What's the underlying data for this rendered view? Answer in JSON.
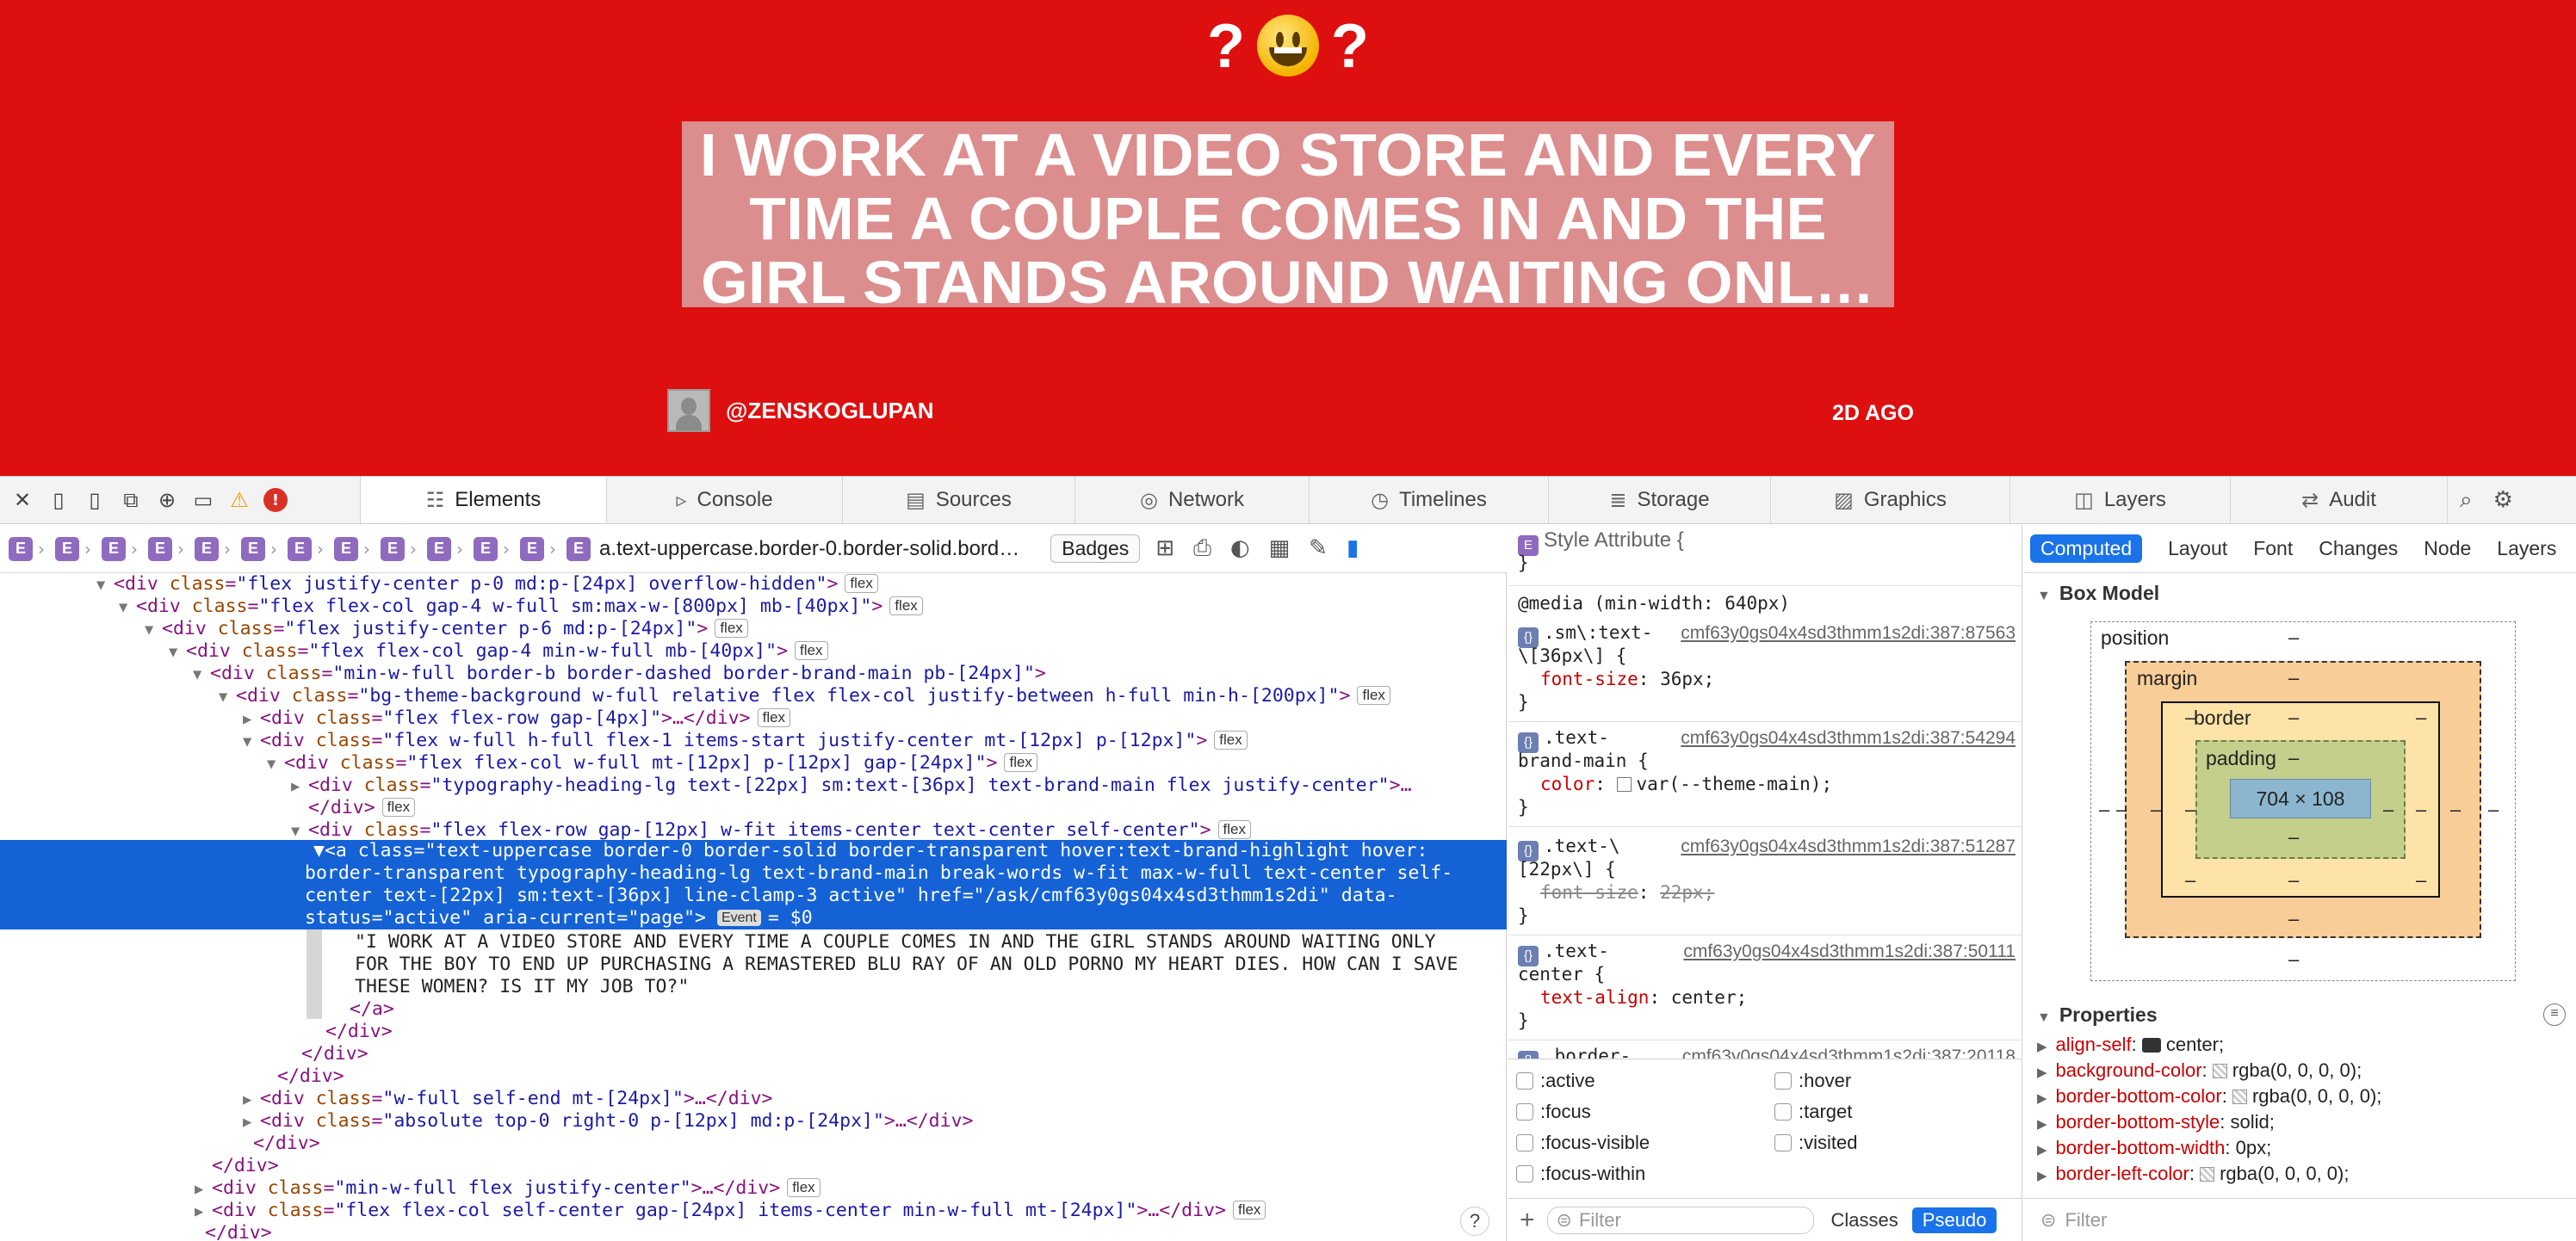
{
  "page": {
    "emoji_left": "?",
    "emoji_right": "?",
    "headline": "I WORK AT A VIDEO STORE AND EVERY TIME A COUPLE COMES IN AND THE GIRL STANDS AROUND WAITING ONL…",
    "author": "@ZENSKOGLUPAN",
    "age": "2D AGO",
    "colors": {
      "background": "#de0f0f",
      "text": "#ffffff"
    }
  },
  "devtools": {
    "tabs": [
      {
        "label": "Elements",
        "icon": "elements-icon"
      },
      {
        "label": "Console",
        "icon": "console-icon"
      },
      {
        "label": "Sources",
        "icon": "sources-icon"
      },
      {
        "label": "Network",
        "icon": "network-icon"
      },
      {
        "label": "Timelines",
        "icon": "timelines-icon"
      },
      {
        "label": "Storage",
        "icon": "storage-icon"
      },
      {
        "label": "Graphics",
        "icon": "graphics-icon"
      },
      {
        "label": "Layers",
        "icon": "layers-icon"
      },
      {
        "label": "Audit",
        "icon": "audit-icon"
      }
    ],
    "breadcrumb_last": "a.text-uppercase.border-0.border-solid.bord…",
    "badges_label": "Badges",
    "flex_badge": "flex",
    "event_badge": "Event",
    "dom": {
      "rows": [
        {
          "open": "<div",
          "attr": "class",
          "val": "\"flex justify-center p-0 md:p-[24px] overflow-hidden\"",
          "close": ">",
          "badge": true
        },
        {
          "open": "<div",
          "attr": "class",
          "val": "\"flex flex-col gap-4 w-full sm:max-w-[800px] mb-[40px]\"",
          "close": ">",
          "badge": true
        },
        {
          "open": "<div",
          "attr": "class",
          "val": "\"flex justify-center p-6 md:p-[24px]\"",
          "close": ">",
          "badge": true
        },
        {
          "open": "<div",
          "attr": "class",
          "val": "\"flex flex-col gap-4 min-w-full mb-[40px]\"",
          "close": ">",
          "badge": true
        },
        {
          "open": "<div",
          "attr": "class",
          "val": "\"min-w-full border-b border-dashed border-brand-main pb-[24px]\"",
          "close": ">",
          "badge": false
        },
        {
          "open": "<div",
          "attr": "class",
          "val": "\"bg-theme-background w-full relative flex flex-col justify-between h-full min-h-[200px]\"",
          "close": ">",
          "badge": true
        },
        {
          "open": "<div",
          "attr": "class",
          "val": "\"flex flex-row gap-[4px]\"",
          "close": ">…</div>",
          "badge": true
        },
        {
          "open": "<div",
          "attr": "class",
          "val": "\"flex w-full h-full flex-1 items-start justify-center mt-[12px] p-[12px]\"",
          "close": ">",
          "badge": true
        },
        {
          "open": "<div",
          "attr": "class",
          "val": "\"flex flex-col w-full mt-[12px] p-[12px] gap-[24px]\"",
          "close": ">",
          "badge": true
        },
        {
          "open": "<div",
          "attr": "class",
          "val": "\"typography-heading-lg text-[22px] sm:text-[36px] text-brand-main flex justify-center\"",
          "close": ">…",
          "badge": false
        },
        {
          "open": "</div>",
          "attr": "",
          "val": "",
          "close": "",
          "badge": true
        },
        {
          "open": "<div",
          "attr": "class",
          "val": "\"flex flex-row gap-[12px] w-fit items-center text-center self-center\"",
          "close": ">",
          "badge": true
        }
      ],
      "selected_lines": [
        "▼<a class=\"text-uppercase border-0 border-solid border-transparent hover:text-brand-highlight hover:",
        "  border-transparent typography-heading-lg text-brand-main break-words w-fit max-w-full text-center self-",
        "  center text-[22px] sm:text-[36px] line-clamp-3 active\" href=\"/ask/cmf63y0gs04x4sd3thmm1s2di\" data-",
        "  status=\"active\" aria-current=\"page\">"
      ],
      "selected_suffix": "= $0",
      "text_lines": [
        "\"I WORK AT A VIDEO STORE AND EVERY TIME A COUPLE COMES IN AND THE GIRL STANDS AROUND WAITING ONLY",
        "FOR THE BOY TO END UP PURCHASING A REMASTERED BLU RAY OF AN OLD PORNO MY HEART DIES. HOW CAN I SAVE",
        "THESE WOMEN? IS IT MY JOB TO?\""
      ],
      "after_rows": [
        "</a>",
        "</div>",
        "</div>",
        "</div>",
        "<div class=\"w-full self-end mt-[24px]\">…</div>",
        "<div class=\"absolute top-0 right-0 p-[12px] md:p-[24px]\">…</div>",
        "</div>",
        "</div>",
        "<div class=\"min-w-full flex justify-center\">…</div>",
        "<div class=\"flex flex-col self-center gap-[24px] items-center min-w-full mt-[24px]\">…</div>",
        "</div>"
      ]
    }
  },
  "styles": {
    "style_attribute": "Style Attribute",
    "media": "@media (min-width: 640px)",
    "rules": [
      {
        "selector": [
          ".sm\\:text-",
          "\\[36px\\]"
        ],
        "source": "cmf63y0gs04x4sd3thmm1s2di:387:87563",
        "prop": "font-size",
        "value": "36px;",
        "struck": false,
        "swatch": false
      },
      {
        "selector": [
          ".text-",
          "brand-main"
        ],
        "source": "cmf63y0gs04x4sd3thmm1s2di:387:54294",
        "prop": "color",
        "value": "var(--theme-main);",
        "struck": false,
        "swatch": true
      },
      {
        "selector": [
          ".text-\\",
          "[22px\\]"
        ],
        "source": "cmf63y0gs04x4sd3thmm1s2di:387:51287",
        "prop": "font-size",
        "value": "22px;",
        "struck": true,
        "swatch": false
      },
      {
        "selector": [
          ".text-",
          "center"
        ],
        "source": "cmf63y0gs04x4sd3thmm1s2di:387:50111",
        "prop": "text-align",
        "value": "center;",
        "struck": false,
        "swatch": false
      }
    ],
    "partial_rule": ".border-",
    "partial_source": "cmf63y0gs04x4sd3thmm1s2di:387:20118",
    "pseudo": [
      ":active",
      ":hover",
      ":focus",
      ":target",
      ":focus-visible",
      ":visited",
      ":focus-within"
    ],
    "filter_placeholder": "Filter",
    "classes_label": "Classes",
    "pseudo_label": "Pseudo"
  },
  "computed": {
    "tabs": [
      "Computed",
      "Layout",
      "Font",
      "Changes",
      "Node",
      "Layers"
    ],
    "box_model_title": "Box Model",
    "labels": {
      "position": "position",
      "margin": "margin",
      "border": "border",
      "padding": "padding"
    },
    "content_size": "704 × 108",
    "dash": "–",
    "properties_title": "Properties",
    "properties": [
      {
        "name": "align-self",
        "value": "center;"
      },
      {
        "name": "background-color",
        "value": "rgba(0, 0, 0, 0);"
      },
      {
        "name": "border-bottom-color",
        "value": "rgba(0, 0, 0, 0);"
      },
      {
        "name": "border-bottom-style",
        "value": "solid;"
      },
      {
        "name": "border-bottom-width",
        "value": "0px;"
      },
      {
        "name": "border-left-color",
        "value": "rgba(0, 0, 0, 0);"
      }
    ],
    "filter_placeholder": "Filter"
  }
}
